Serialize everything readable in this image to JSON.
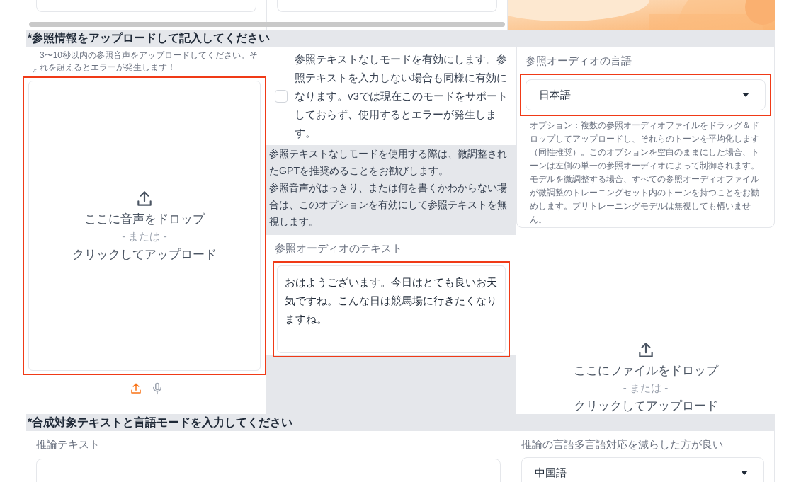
{
  "reference_section": {
    "title": "*参照情報をアップロードして記入してください",
    "audio_upload": {
      "hint": "3〜10秒以内の参照音声をアップロードしてください。それを超えるとエラーが発生します！",
      "drop_text": "ここに音声をドロップ",
      "or_text": "- または -",
      "click_text": "クリックしてアップロード",
      "highlighted": true,
      "sources": [
        {
          "kind": "upload",
          "selected": true
        },
        {
          "kind": "microphone",
          "selected": false
        }
      ]
    },
    "no_ref_mode": {
      "label": "参照テキストなしモードを有効にします。参照テキストを入力しない場合も同様に有効になります。v3では現在このモードをサポートしておらず、使用するとエラーが発生します。",
      "checked": false
    },
    "no_ref_info": [
      "参照テキストなしモードを使用する際は、微調整されたGPTを推奨めることをお勧びします。",
      "参照音声がはっきり、または何を書くかわからない場合は、このオプションを有効にして参照テキストを無視します。"
    ],
    "ref_text": {
      "label": "参照オーディオのテキスト",
      "value": "おはようございます。今日はとても良いお天気ですね。こんな日は競馬場に行きたくなりますね。",
      "highlighted": true
    },
    "ref_language": {
      "label": "参照オーディオの言語",
      "value": "日本語",
      "highlighted": true
    },
    "multi_ref": {
      "hint": "オプション：複数の参照オーディオファイルをドラッグ＆ドロップしてアップロードし、それらのトーンを平均化します（同性推奨）。このオプションを空白のままにした場合、トーンは左側の単一の参照オーディオによって制御されます。モデルを微調整する場合、すべての参照オーディオファイルが微調整のトレーニングセット内のトーンを持つことをお勧めします。プリトレーニングモデルは無視しても構いません。",
      "drop_text": "ここにファイルをドロップ",
      "or_text": "- または -",
      "click_text": "クリックしてアップロード"
    }
  },
  "synthesis_section": {
    "title": "*合成対象テキストと言語モードを入力してください",
    "inference_text": {
      "label": "推論テキスト"
    },
    "inference_language": {
      "label": "推論の言語多言語対応を減らした方が良い",
      "value": "中国語"
    }
  }
}
